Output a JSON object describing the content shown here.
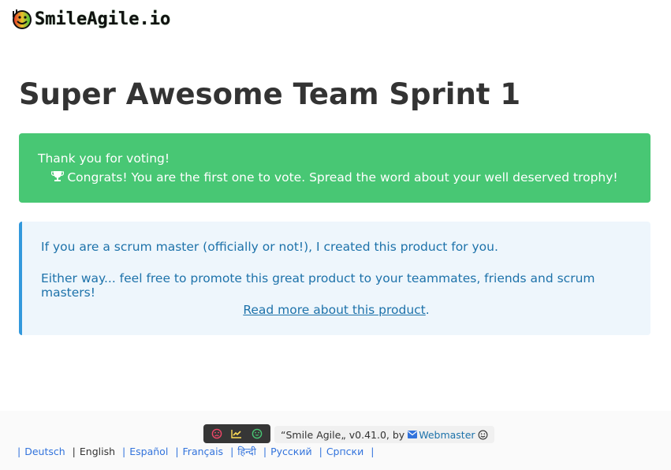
{
  "brand": {
    "name": "SmileAgile.io",
    "logo_icon": "smiley-face-logo"
  },
  "page": {
    "title": "Super Awesome Team Sprint 1"
  },
  "success_alert": {
    "line1": "Thank you for voting!",
    "trophy_icon": "trophy-icon",
    "line2": "Congrats! You are the first one to vote. Spread the word about your well deserved trophy!",
    "color": "#48c774"
  },
  "info_box": {
    "paragraph1": "If you are a scrum master (officially or not!), I created this product for you.",
    "paragraph2": "Either way... feel free to promote this great product to your teammates, friends and scrum masters!",
    "link_text": "Read more about this product",
    "link_suffix": ".",
    "color": "#3298dc"
  },
  "footer": {
    "toolbar": [
      {
        "icon": "sad-face-icon",
        "color": "#f14668"
      },
      {
        "icon": "chart-line-icon",
        "color": "#ffdd57"
      },
      {
        "icon": "happy-face-icon",
        "color": "#48c774"
      }
    ],
    "credit_prefix": "“Smile Agile„ v0.41.0, by",
    "webmaster_label": "Webmaster",
    "languages": [
      {
        "label": "Deutsch",
        "current": false
      },
      {
        "label": "English",
        "current": true
      },
      {
        "label": "Español",
        "current": false
      },
      {
        "label": "Français",
        "current": false
      },
      {
        "label": "हिन्दी",
        "current": false
      },
      {
        "label": "Русский",
        "current": false
      },
      {
        "label": "Српски",
        "current": false
      }
    ],
    "separator": "|"
  }
}
